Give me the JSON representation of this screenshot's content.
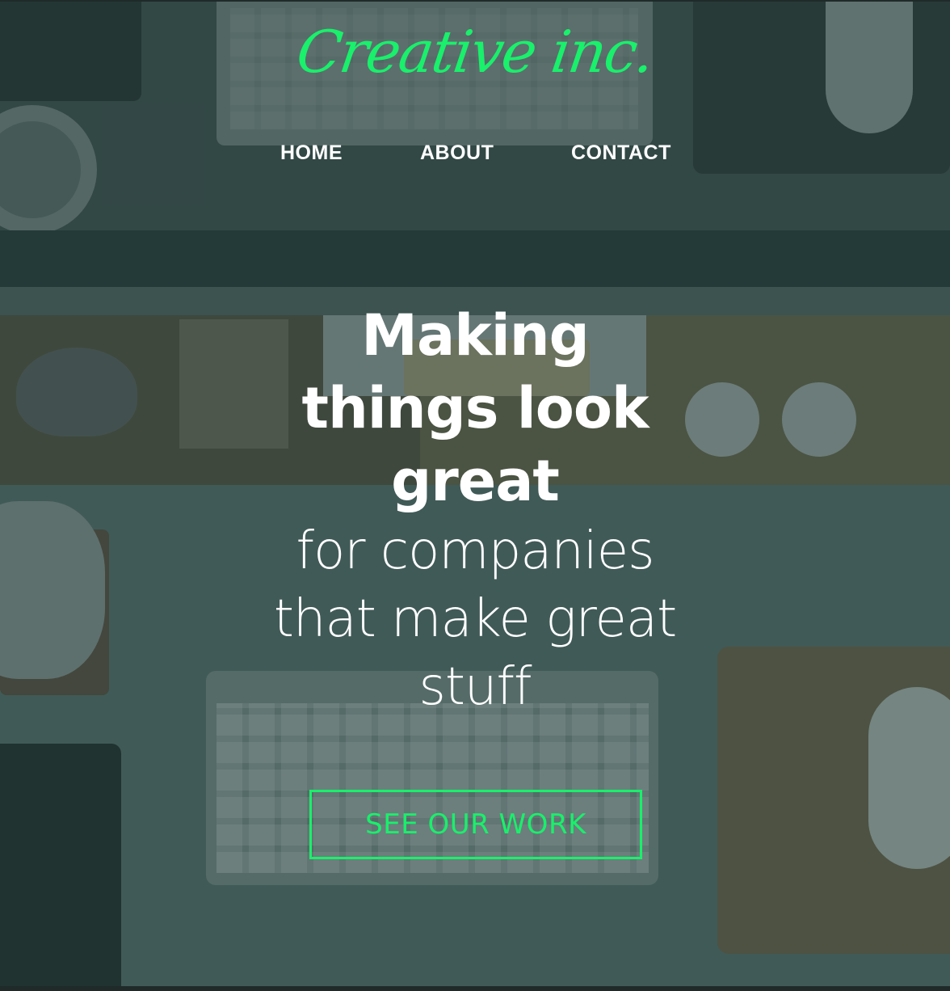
{
  "brand": {
    "logo_text": "Creative inc.",
    "accent_color": "#19f06b"
  },
  "nav": {
    "items": [
      {
        "label": "HOME"
      },
      {
        "label": "ABOUT"
      },
      {
        "label": "CONTACT"
      }
    ]
  },
  "hero": {
    "headline_line1": "Making",
    "headline_line2": "things look",
    "headline_line3": "great",
    "subline_line1": "for companies",
    "subline_line2": "that make great",
    "subline_line3": "stuff"
  },
  "cta": {
    "label": "SEE OUR WORK"
  }
}
